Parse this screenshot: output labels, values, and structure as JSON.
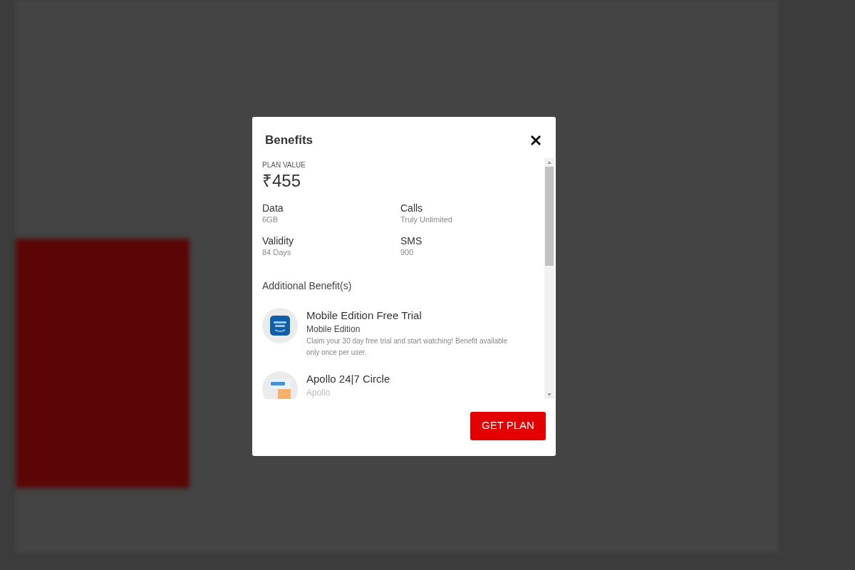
{
  "dialog": {
    "title": "Benefits",
    "plan_value": {
      "label": "PLAN VALUE",
      "amount": "₹455"
    },
    "details": [
      {
        "label": "Data",
        "value": "6GB"
      },
      {
        "label": "Calls",
        "value": "Truly Unlimited"
      },
      {
        "label": "Validity",
        "value": "84 Days"
      },
      {
        "label": "SMS",
        "value": "900"
      }
    ],
    "additional_heading": "Additional Benefit(s)",
    "benefits": [
      {
        "kind": "video",
        "title": "Mobile Edition Free Trial",
        "subtitle": "Mobile Edition",
        "description": "Claim your 30 day free trial and start watching! Benefit available only once per user."
      },
      {
        "kind": "health",
        "title": "Apollo 24|7 Circle",
        "subtitle": "Apollo"
      }
    ],
    "button": "GET PLAN"
  }
}
